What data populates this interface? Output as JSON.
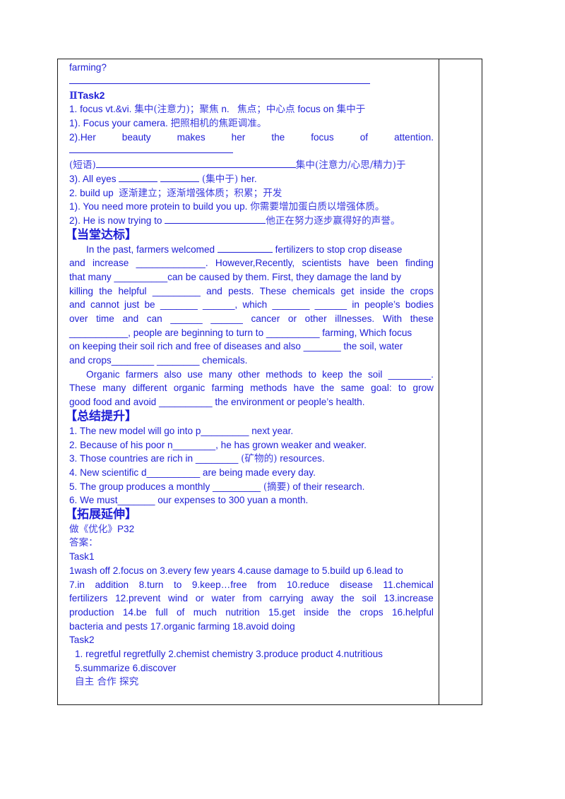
{
  "document": {
    "continuation": "farming?",
    "task2": {
      "title_prefix": "Ⅱ",
      "title": "Task2",
      "item1": {
        "head_en": "1. focus vt.&vi.",
        "head_cn": "集中(注意力)；聚焦",
        "head_n": "n.",
        "head_cn2": "焦点；中心点",
        "phrase_en": "focus on",
        "phrase_cn": "集中于",
        "ex1_en": "1). Focus your camera.",
        "ex1_cn": "把照相机的焦距调准。",
        "ex2_words": [
          "2).Her",
          "beauty",
          "makes",
          "her",
          "the",
          "focus",
          "of",
          "attention."
        ],
        "phrase_label": "(短语)",
        "phrase_meaning": "集中(注意力/心思/精力)于",
        "ex3_pre": "3). All eyes",
        "ex3_cn": "(集中于)",
        "ex3_post": "her."
      },
      "item2": {
        "head_en": "2. build up",
        "head_cn": "逐渐建立；逐渐增强体质；积累；开发",
        "ex1_en": "1). You need more protein to build you up.",
        "ex1_cn": "你需要增加蛋白质以增强体质。",
        "ex2_en": "2). He is now trying to",
        "ex2_cn": "他正在努力逐步赢得好的声誉。"
      }
    },
    "section_practice": {
      "heading": "【当堂达标】",
      "p1": [
        {
          "pre": "In the past, farmers welcomed",
          "post": "fertilizers to stop crop disease"
        },
        {
          "words": [
            "and",
            "increase",
            "_____________.",
            "However,Recently,",
            "scientists",
            "have",
            "been",
            "finding"
          ]
        },
        {
          "text": "that many __________can be caused by them. First, they damage the land by"
        },
        {
          "words": [
            "killing",
            "the",
            "helpful",
            "_________",
            "and",
            "pests.",
            "These",
            "chemicals",
            "get",
            "inside",
            "the",
            "crops"
          ]
        },
        {
          "words": [
            "and",
            "cannot",
            "just",
            "be",
            "_______",
            "______,",
            "which",
            "_______",
            "______",
            "in",
            "people’s",
            "bodies"
          ]
        },
        {
          "words": [
            "over",
            "time",
            "and",
            "can",
            "______",
            "______",
            "cancer",
            "or",
            "other",
            "illnesses.",
            "With",
            "these"
          ]
        },
        {
          "text": "___________, people are beginning to turn to __________ farming, Which focus"
        },
        {
          "text": "on keeping their soil rich and free of diseases and also _______ the soil, water"
        },
        {
          "text": "and crops________ ________ chemicals."
        }
      ],
      "p2": [
        {
          "words": [
            "Organic",
            "farmers",
            "also",
            "use",
            "many",
            "other",
            "methods",
            "to",
            "keep",
            "the",
            "soil",
            "________."
          ]
        },
        {
          "words": [
            "These",
            "many",
            "different",
            "organic",
            "farming",
            "methods",
            "have",
            "the",
            "same",
            "goal:",
            "to",
            "grow"
          ]
        },
        {
          "text": "good food and avoid __________ the environment or people’s health."
        }
      ]
    },
    "section_summary": {
      "heading": "【总结提升】",
      "items": [
        {
          "pre": "1. The new model will go into p_________ next year."
        },
        {
          "pre": "2. Because of his poor n________, he has grown weaker and weaker."
        },
        {
          "pre": "3. Those countries are rich in ________ ",
          "cn": "(矿物的)",
          "post": " resources."
        },
        {
          "pre": "4. New scientific d__________ are being made every day."
        },
        {
          "pre": "5. The group produces a monthly _________ ",
          "cn": "(摘要)",
          "post": " of their research."
        },
        {
          "pre": "6. We must_______ our expenses to 300 yuan a month."
        }
      ]
    },
    "section_extend": {
      "heading": "【拓展延伸】",
      "assignment_cn": "做《优化》",
      "assignment_page": "P32",
      "answers_label": "答案：",
      "task1_label": "Task1",
      "task1_lines": [
        {
          "text": "1wash off 2.focus on 3.every few years 4.cause damage to 5.build up 6.lead to"
        },
        {
          "words": [
            "7.in",
            "addition",
            "8.turn",
            "to",
            "9.keep…free",
            "from",
            "10.reduce",
            "disease",
            "11.chemical"
          ]
        },
        {
          "words": [
            "fertilizers",
            "12.prevent",
            "wind",
            "or",
            "water",
            "from",
            "carrying",
            "away",
            "the",
            "soil",
            "13.increase"
          ]
        },
        {
          "words": [
            "production",
            "14.be",
            "full",
            "of",
            "much",
            "nutrition",
            "15.get",
            "inside",
            "the",
            "crops",
            "16.helpful"
          ]
        },
        {
          "text": "bacteria and pests 17.organic farming 18.avoid doing"
        }
      ],
      "task2_label": "Task2",
      "task2_lines": [
        "1.   regretful regretfully 2.chemist chemistry 3.produce product 4.nutritious",
        "5.summarize 6.discover"
      ],
      "footer_cn": "自主  合作  探究"
    }
  },
  "colors": {
    "text": "#1f1fd6",
    "border": "#1a1a1a"
  }
}
